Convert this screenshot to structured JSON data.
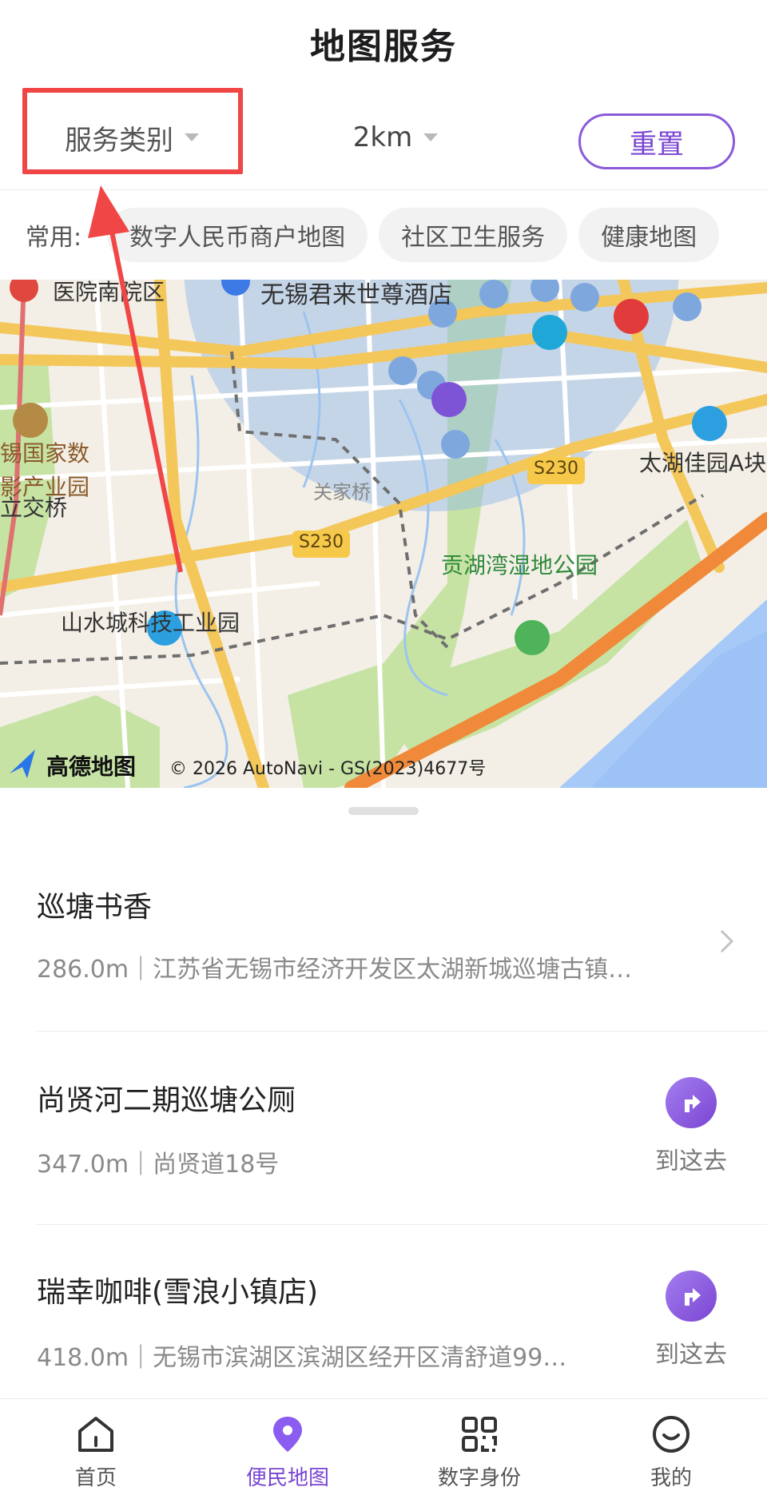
{
  "header": {
    "title": "地图服务"
  },
  "filters": {
    "category_label": "服务类别",
    "distance_label": "2km",
    "reset_label": "重置"
  },
  "common": {
    "label": "常用:",
    "chips": [
      "数字人民币商户地图",
      "社区卫生服务",
      "健康地图"
    ]
  },
  "map": {
    "labels": {
      "hospital": "医院南院区",
      "hotel": "无锡君来世尊酒店",
      "film_park_1": "锡国家数",
      "film_park_2": "影产业园",
      "guanjia": "关家桥",
      "taihu": "太湖佳园A块",
      "road_a": "S230",
      "road_b": "S230",
      "bridge": "立交桥",
      "wetland": "贡湖湾湿地公园",
      "industrial": "山水城科技工业园"
    },
    "logo": "高德地图",
    "copyright": "© 2026 AutoNavi - GS(2023)4677号"
  },
  "results": [
    {
      "name": "巡塘书香",
      "detail": "286.0m｜江苏省无锡市经济开发区太湖新城巡塘古镇…",
      "action": ""
    },
    {
      "name": "尚贤河二期巡塘公厕",
      "detail": "347.0m｜尚贤道18号",
      "action": "到这去"
    },
    {
      "name": "瑞幸咖啡(雪浪小镇店)",
      "detail": "418.0m｜无锡市滨湖区滨湖区经开区清舒道99…",
      "action": "到这去"
    }
  ],
  "tabs": [
    {
      "label": "首页",
      "icon": "home-icon"
    },
    {
      "label": "便民地图",
      "icon": "map-pin-icon"
    },
    {
      "label": "数字身份",
      "icon": "qr-code-icon"
    },
    {
      "label": "我的",
      "icon": "smile-icon"
    }
  ],
  "colors": {
    "accent": "#7a45d2",
    "highlight": "#f04646"
  }
}
